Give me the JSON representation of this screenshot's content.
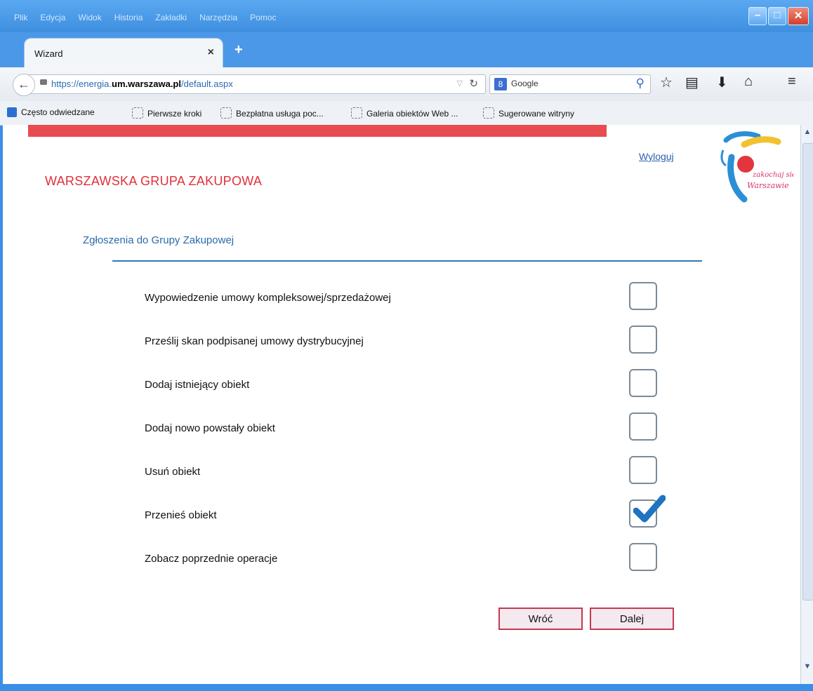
{
  "menu": [
    "Plik",
    "Edycja",
    "Widok",
    "Historia",
    "Zakładki",
    "Narzędzia",
    "Pomoc"
  ],
  "tab": {
    "title": "Wizard",
    "close": "×",
    "new_tab": "+"
  },
  "nav": {
    "url_scheme": "https://energia.",
    "url_domain": "um.warszawa.pl",
    "url_path": "/default.aspx",
    "search_engine": "Google"
  },
  "bookmarks": [
    "Często odwiedzane",
    "Pierwsze kroki",
    "Bezpłatna usługa poc...",
    "Galeria obiektów Web ...",
    "Sugerowane witryny"
  ],
  "page": {
    "logout": "Wyloguj",
    "brand": "WARSZAWSKA GRUPA ZAKUPOWA",
    "section_title": "Zgłoszenia do Grupy Zakupowej",
    "logo_text": "zakochaj się w Warszawie",
    "options": [
      {
        "label": "Wypowiedzenie umowy kompleksowej/sprzedażowej",
        "checked": false
      },
      {
        "label": "Prześlij skan podpisanej umowy dystrybucyjnej",
        "checked": false
      },
      {
        "label": "Dodaj istniejący obiekt",
        "checked": false
      },
      {
        "label": "Dodaj nowo powstały obiekt",
        "checked": false
      },
      {
        "label": "Usuń obiekt",
        "checked": false
      },
      {
        "label": "Przenieś obiekt",
        "checked": true
      },
      {
        "label": "Zobacz poprzednie operacje",
        "checked": false
      }
    ],
    "back_button": "Wróć",
    "next_button": "Dalej"
  },
  "colors": {
    "accent_red": "#e0303a",
    "accent_blue": "#2a6aa9",
    "check_blue": "#1f73c0"
  }
}
